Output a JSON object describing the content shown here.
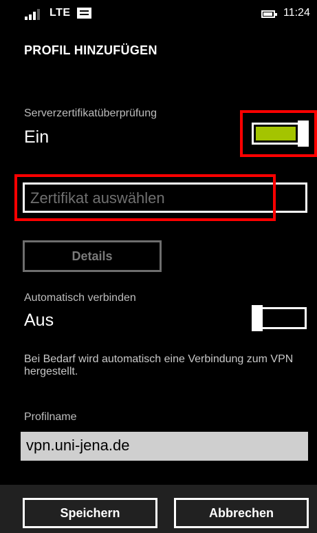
{
  "status_bar": {
    "network": "LTE",
    "time": "11:24"
  },
  "page_title": "PROFIL HINZUFÜGEN",
  "server_cert_check": {
    "label": "Serverzertifikatüberprüfung",
    "value": "Ein",
    "enabled": true
  },
  "certificate_input": {
    "placeholder": "Zertifikat auswählen",
    "value": ""
  },
  "details_button": {
    "label": "Details",
    "enabled": false
  },
  "auto_connect": {
    "label": "Automatisch verbinden",
    "value": "Aus",
    "enabled": false,
    "description": "Bei Bedarf wird automatisch eine Verbindung zum VPN hergestellt."
  },
  "profile_name": {
    "label": "Profilname",
    "value": "vpn.uni-jena.de"
  },
  "app_bar": {
    "save_label": "Speichern",
    "cancel_label": "Abbrechen"
  },
  "colors": {
    "accent": "#a4c400",
    "highlight": "#ff0000",
    "background": "#000000",
    "app_bar": "#212121"
  }
}
